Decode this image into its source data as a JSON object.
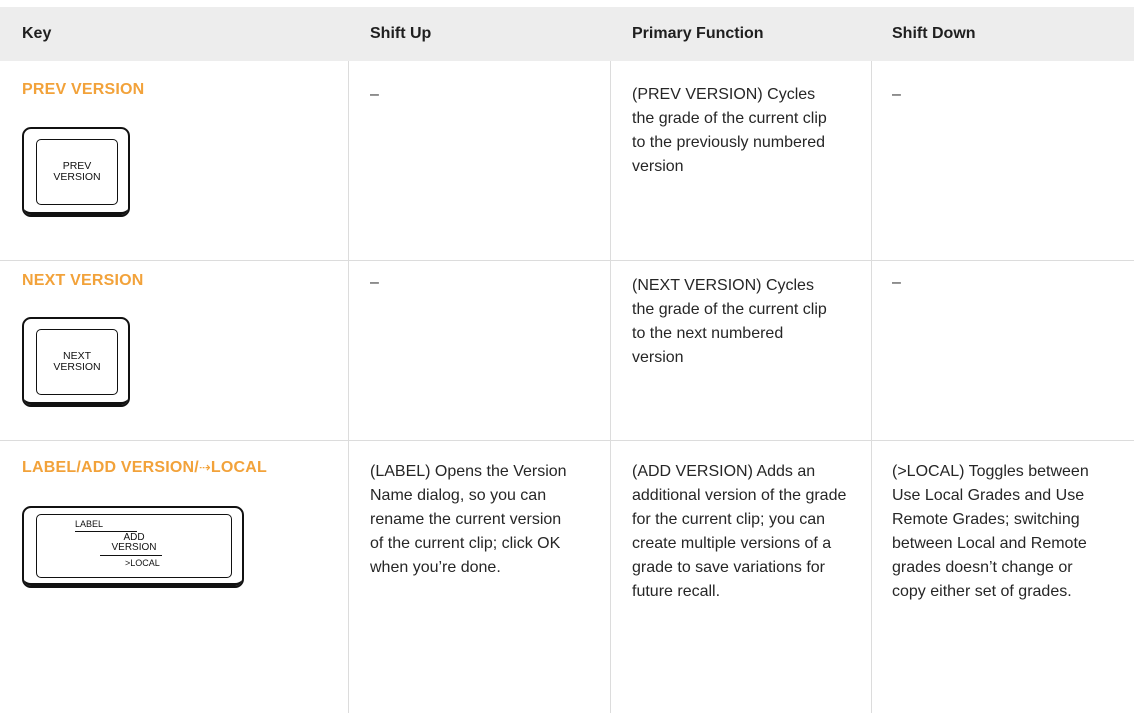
{
  "headers": {
    "key": "Key",
    "shift_up": "Shift Up",
    "primary": "Primary Function",
    "shift_down": "Shift Down"
  },
  "rows": [
    {
      "title": "PREV VERSION",
      "keycap_lines": [
        "PREV",
        "VERSION"
      ],
      "shift_up": "–",
      "primary": "(PREV VERSION) Cycles the grade of the current clip to the previously numbered version",
      "shift_down": "–"
    },
    {
      "title": "NEXT VERSION",
      "keycap_lines": [
        "NEXT",
        "VERSION"
      ],
      "shift_up": "–",
      "primary": "(NEXT VERSION) Cycles the grade of the current clip to the next numbered version",
      "shift_down": "–"
    },
    {
      "title_a": "LABEL/ADD VERSION/",
      "title_arrow": "⇢",
      "title_b": "LOCAL",
      "keycap_top": "LABEL",
      "keycap_mid": [
        "ADD",
        "VERSION"
      ],
      "keycap_bottom": ">LOCAL",
      "shift_up": "(LABEL) Opens the Version Name dialog, so you can rename the current version of the current clip; click OK when you’re done.",
      "primary": "(ADD VERSION) Adds an additional version of the grade for the current clip; you can create multiple versions of a grade to save variations for future recall.",
      "shift_down": "(>LOCAL) Toggles between Use Local Grades and Use Remote Grades; switching between Local and Remote grades doesn’t change or copy either set of grades."
    }
  ]
}
